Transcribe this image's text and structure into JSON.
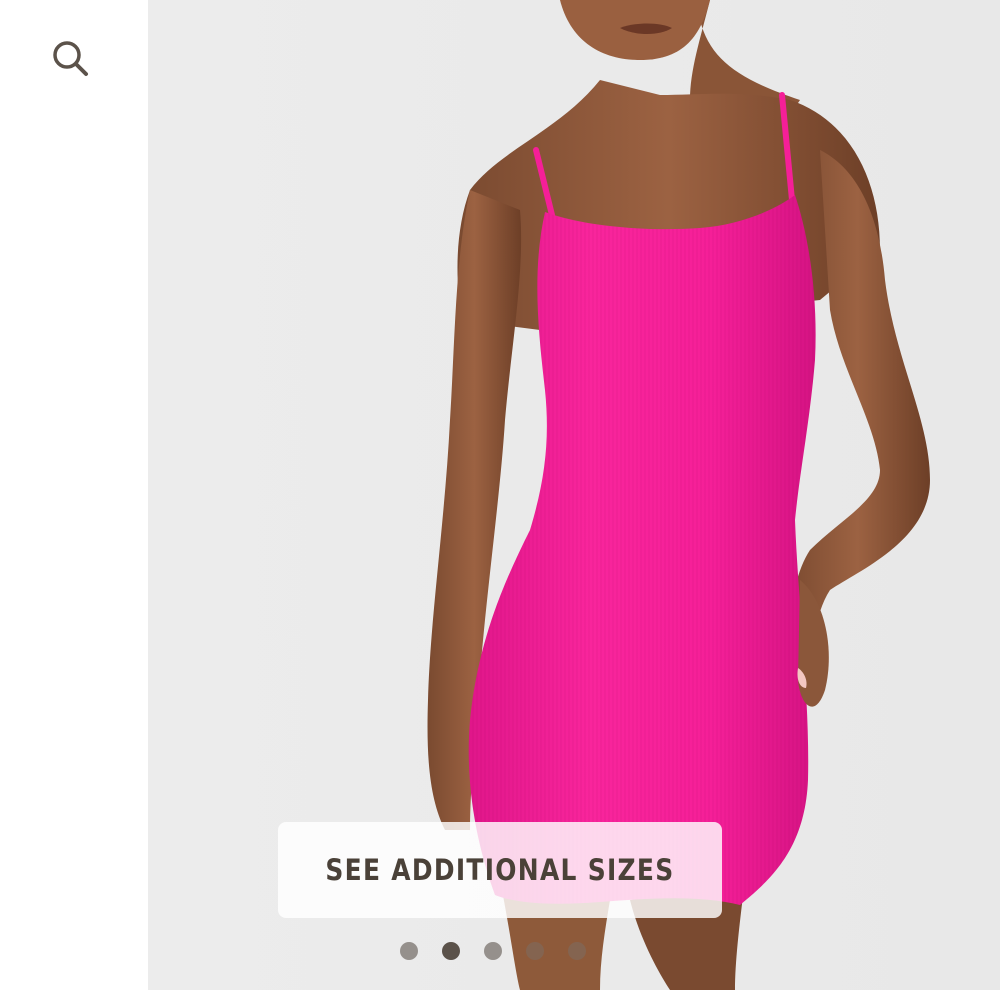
{
  "header": {
    "search_icon": "search-icon"
  },
  "product": {
    "image_subject": "pink ribbed slip mini dress",
    "dress_color": "#f51f98",
    "background_color": "#ebebeb"
  },
  "cta": {
    "label": "SEE ADDITIONAL SIZES"
  },
  "carousel": {
    "total": 5,
    "active_index": 1
  }
}
